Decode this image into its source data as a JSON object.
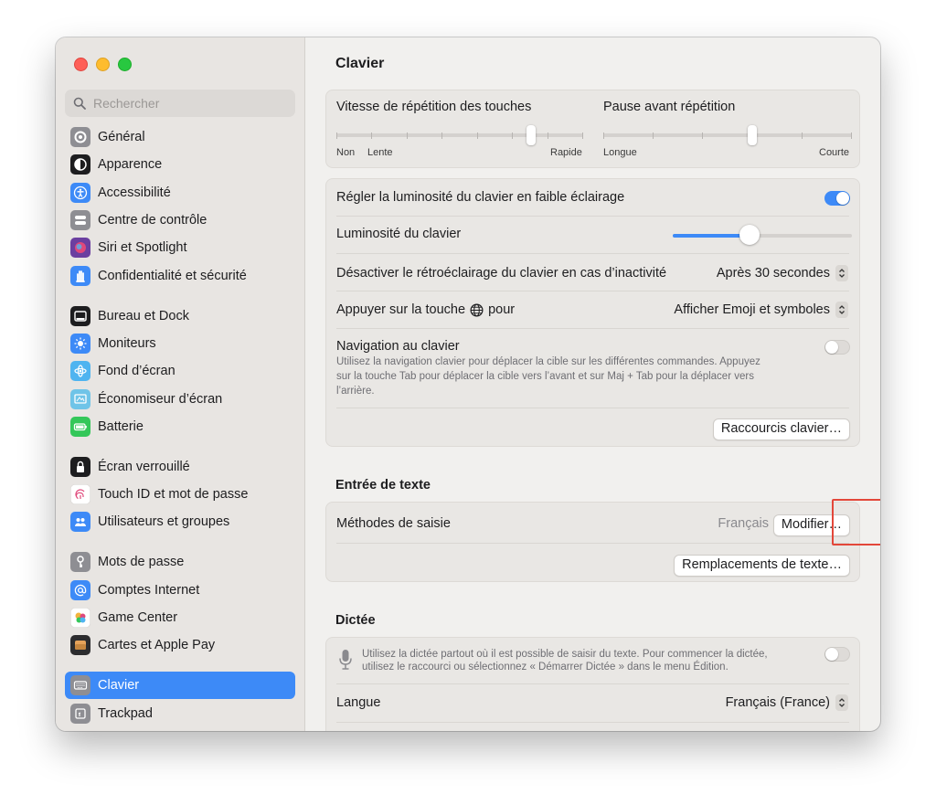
{
  "window": {
    "title": "Clavier"
  },
  "sidebar": {
    "search_placeholder": "Rechercher",
    "groups": [
      [
        {
          "label": "Général",
          "icon": "gear-icon",
          "color": "#8e8e93"
        },
        {
          "label": "Apparence",
          "icon": "appearance-icon",
          "color": "#1d1d1f"
        },
        {
          "label": "Accessibilité",
          "icon": "accessibility-icon",
          "color": "#3d8af7"
        },
        {
          "label": "Centre de contrôle",
          "icon": "control-center-icon",
          "color": "#8e8e93"
        },
        {
          "label": "Siri et Spotlight",
          "icon": "siri-icon",
          "color": "#6b3fa0"
        },
        {
          "label": "Confidentialité et sécurité",
          "icon": "hand-icon",
          "color": "#3d8af7"
        }
      ],
      [
        {
          "label": "Bureau et Dock",
          "icon": "dock-icon",
          "color": "#1d1d1f"
        },
        {
          "label": "Moniteurs",
          "icon": "display-icon",
          "color": "#3d8af7"
        },
        {
          "label": "Fond d’écran",
          "icon": "wallpaper-icon",
          "color": "#4fb4f0"
        },
        {
          "label": "Économiseur d’écran",
          "icon": "screensaver-icon",
          "color": "#6fc4e8"
        },
        {
          "label": "Batterie",
          "icon": "battery-icon",
          "color": "#34c759"
        }
      ],
      [
        {
          "label": "Écran verrouillé",
          "icon": "lock-icon",
          "color": "#1d1d1f"
        },
        {
          "label": "Touch ID et mot de passe",
          "icon": "fingerprint-icon",
          "color": "#ffffff"
        },
        {
          "label": "Utilisateurs et groupes",
          "icon": "users-icon",
          "color": "#3d8af7"
        }
      ],
      [
        {
          "label": "Mots de passe",
          "icon": "key-icon",
          "color": "#8e8e93"
        },
        {
          "label": "Comptes Internet",
          "icon": "at-icon",
          "color": "#3d8af7"
        },
        {
          "label": "Game Center",
          "icon": "game-center-icon",
          "color": "#ffffff"
        },
        {
          "label": "Cartes et Apple Pay",
          "icon": "wallet-icon",
          "color": "#2c2c2e"
        }
      ],
      [
        {
          "label": "Clavier",
          "icon": "keyboard-icon",
          "color": "#8e8e93",
          "active": true
        },
        {
          "label": "Trackpad",
          "icon": "trackpad-icon",
          "color": "#8e8e93"
        }
      ]
    ]
  },
  "repeat": {
    "rate_label": "Vitesse de répétition des touches",
    "rate_labels": [
      "Non",
      "Lente",
      "Rapide"
    ],
    "rate_value": 0.79,
    "delay_label": "Pause avant répétition",
    "delay_labels": [
      "Longue",
      "Courte"
    ],
    "delay_value": 0.6
  },
  "backlight": {
    "auto_label": "Régler la luminosité du clavier en faible éclairage",
    "auto_on": true,
    "brightness_label": "Luminosité du clavier",
    "brightness_value": 0.43,
    "inactivity_label": "Désactiver le rétroéclairage du clavier en cas d’inactivité",
    "inactivity_value": "Après 30 secondes",
    "globe_label_before": "Appuyer sur la touche",
    "globe_label_after": "pour",
    "globe_value": "Afficher Emoji et symboles",
    "nav_label": "Navigation au clavier",
    "nav_on": false,
    "nav_desc_1": "Utilisez la navigation clavier pour déplacer la cible sur les différentes commandes. Appuyez",
    "nav_desc_2": "sur la touche Tab pour déplacer la cible vers l’avant et sur Maj + Tab pour la déplacer vers",
    "nav_desc_3": "l’arrière.",
    "shortcuts_button": "Raccourcis clavier…"
  },
  "text_input": {
    "title": "Entrée de texte",
    "methods_label": "Méthodes de saisie",
    "methods_value": "Français",
    "modify_button": "Modifier…",
    "replacements_button": "Remplacements de texte…"
  },
  "dictation": {
    "title": "Dictée",
    "desc_1": "Utilisez la dictée partout où il est possible de saisir du texte. Pour commencer la dictée,",
    "desc_2": "utilisez le raccourci ou sélectionnez « Démarrer Dictée » dans le menu Édition.",
    "on": false,
    "language_label": "Langue",
    "language_value": "Français (France)"
  },
  "colors": {
    "accent": "#3d8af7",
    "highlight": "#e3473a"
  }
}
